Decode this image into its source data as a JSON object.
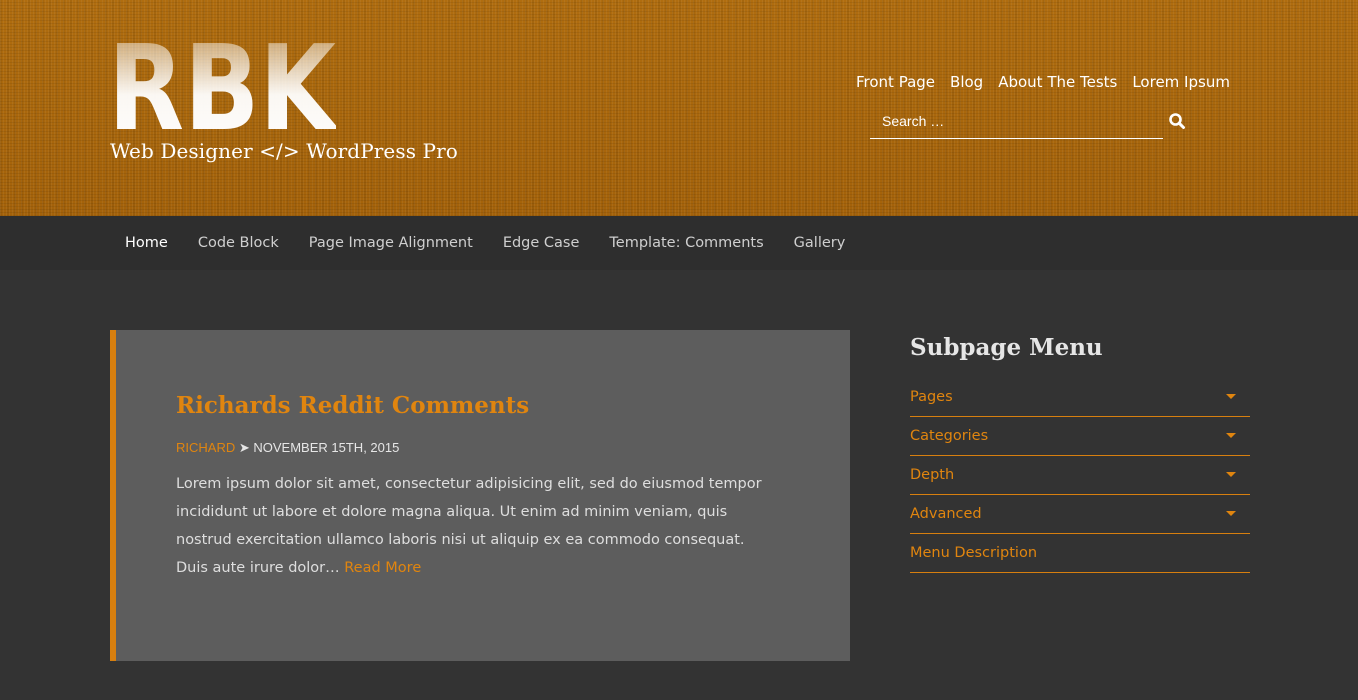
{
  "brand": {
    "logo_text": "RBK",
    "tagline": "Web Designer </> WordPress Pro"
  },
  "top_nav": [
    "Front Page",
    "Blog",
    "About The Tests",
    "Lorem Ipsum"
  ],
  "search": {
    "placeholder": "Search …"
  },
  "main_nav": {
    "items": [
      "Home",
      "Code Block",
      "Page Image Alignment",
      "Edge Case",
      "Template: Comments",
      "Gallery"
    ],
    "active": "Home"
  },
  "post": {
    "title": "Richards Reddit Comments",
    "author": "RICHARD",
    "separator": "➤",
    "date": "NOVEMBER 15TH, 2015",
    "excerpt": "Lorem ipsum dolor sit amet, consectetur adipisicing elit, sed do eiusmod tempor incididunt ut labore et dolore magna aliqua. Ut enim ad minim veniam, quis nostrud exercitation ullamco laboris nisi ut aliquip ex ea commodo consequat. Duis aute irure dolor… ",
    "read_more": "Read More"
  },
  "sidebar": {
    "title": "Subpage Menu",
    "items": [
      {
        "label": "Pages",
        "has_dropdown": true
      },
      {
        "label": "Categories",
        "has_dropdown": true
      },
      {
        "label": "Depth",
        "has_dropdown": true
      },
      {
        "label": "Advanced",
        "has_dropdown": true
      },
      {
        "label": "Menu Description",
        "has_dropdown": false
      }
    ]
  },
  "colors": {
    "accent": "#e0850f",
    "header_bg": "#a8660b",
    "nav_bg": "#2e2e2e",
    "page_bg": "#333333",
    "card_bg": "#5d5d5d"
  },
  "icons": {
    "search": "search-icon",
    "dropdown": "caret-down-icon"
  }
}
